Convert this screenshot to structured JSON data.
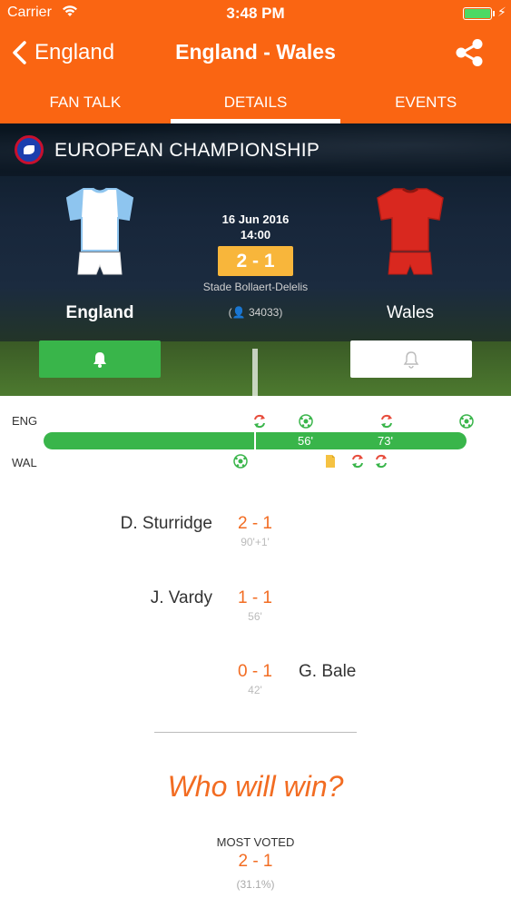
{
  "status_bar": {
    "carrier": "Carrier",
    "time": "3:48 PM",
    "battery_percent": 100
  },
  "nav": {
    "back_label": "England",
    "title": "England - Wales"
  },
  "tabs": [
    {
      "label": "FAN TALK",
      "active": false
    },
    {
      "label": "DETAILS",
      "active": true
    },
    {
      "label": "EVENTS",
      "active": false
    }
  ],
  "competition": {
    "name": "EUROPEAN CHAMPIONSHIP"
  },
  "match": {
    "date": "16 Jun 2016",
    "time": "14:00",
    "score": "2 - 1",
    "venue": "Stade Bollaert-Delelis",
    "attendance": "34033",
    "home": {
      "name": "England",
      "shirt_color": "#ffffff",
      "sleeve_color": "#8ec5ef",
      "alerts_on": true
    },
    "away": {
      "name": "Wales",
      "shirt_color": "#d9281f",
      "sleeve_color": "#d9281f",
      "alerts_on": false
    }
  },
  "timeline": {
    "home_code": "ENG",
    "away_code": "WAL",
    "markers": [
      "56'",
      "73'"
    ],
    "home_events": [
      {
        "type": "substitution",
        "icon": "substitution-icon"
      },
      {
        "type": "goal",
        "icon": "ball-icon"
      },
      {
        "type": "substitution",
        "icon": "substitution-icon"
      },
      {
        "type": "goal",
        "icon": "ball-icon"
      }
    ],
    "away_events": [
      {
        "type": "goal",
        "icon": "ball-icon"
      },
      {
        "type": "yellow-card",
        "icon": "yellow-card-icon"
      },
      {
        "type": "substitution",
        "icon": "substitution-icon"
      },
      {
        "type": "substitution",
        "icon": "substitution-icon"
      }
    ]
  },
  "goals": [
    {
      "scorer": "D. Sturridge",
      "side": "home",
      "score": "2 - 1",
      "minute": "90'+1'"
    },
    {
      "scorer": "J. Vardy",
      "side": "home",
      "score": "1 - 1",
      "minute": "56'"
    },
    {
      "scorer": "G. Bale",
      "side": "away",
      "score": "0 - 1",
      "minute": "42'"
    }
  ],
  "prediction": {
    "title": "Who will win?",
    "most_voted_label": "MOST VOTED",
    "most_voted_score": "2 - 1",
    "most_voted_percent": "(31.1%)"
  },
  "colors": {
    "brand_orange": "#fa6512",
    "score_orange": "#f26c22",
    "score_box": "#f8b63b",
    "timeline_green": "#39b54a"
  }
}
